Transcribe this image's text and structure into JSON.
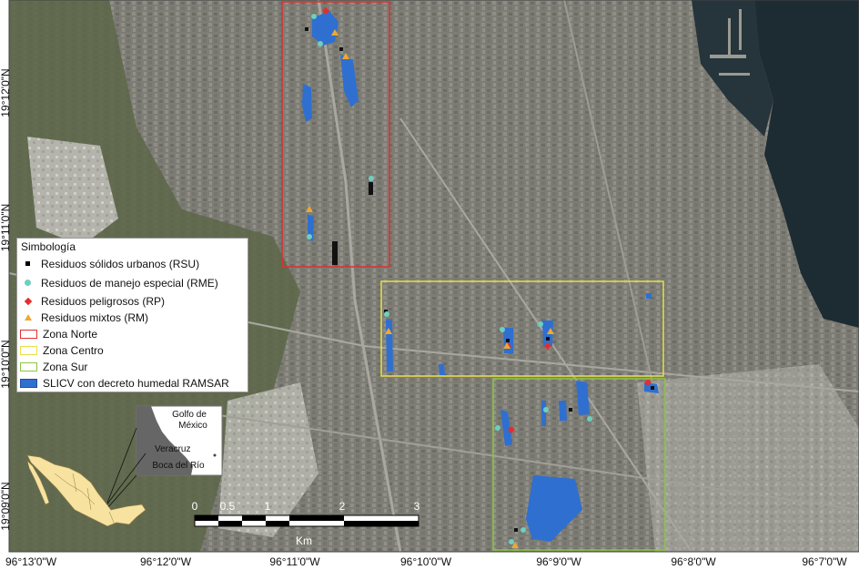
{
  "legend": {
    "title": "Simbología",
    "items": [
      {
        "label": "Residuos sólidos urbanos (RSU)",
        "icon": "black-square-icon",
        "color": "#000000"
      },
      {
        "label": "Residuos de manejo especial (RME)",
        "icon": "teal-circle-icon",
        "color": "#6ecfc0"
      },
      {
        "label": "Residuos peligrosos (RP)",
        "icon": "red-diamond-icon",
        "color": "#e52d2d"
      },
      {
        "label": "Residuos mixtos (RM)",
        "icon": "orange-triangle-icon",
        "color": "#f0a830"
      },
      {
        "label": "Zona Norte",
        "icon": "red-box-icon",
        "color": "#e03030"
      },
      {
        "label": "Zona Centro",
        "icon": "yellow-box-icon",
        "color": "#e8e04a"
      },
      {
        "label": "Zona Sur",
        "icon": "green-box-icon",
        "color": "#8cc63f"
      },
      {
        "label": "SLICV con decreto humedal RAMSAR",
        "icon": "blue-box-icon",
        "color": "#2f6fd0"
      }
    ]
  },
  "axes": {
    "x_labels": [
      "96°13'0\"W",
      "96°12'0\"W",
      "96°11'0\"W",
      "96°10'0\"W",
      "96°9'0\"W",
      "96°8'0\"W",
      "96°7'0\"W"
    ],
    "y_labels": [
      "19°12'0\"N",
      "19°11'0\"N",
      "19°10'0\"N",
      "19°09'0\"N"
    ]
  },
  "inset": {
    "gulf_label_1": "Golfo de",
    "gulf_label_2": "México",
    "city_1": "Veracruz",
    "city_2": "Boca del Río"
  },
  "scale_bar": {
    "ticks": [
      "0",
      "0.5",
      "1",
      "2",
      "3"
    ],
    "unit": "Km"
  },
  "colors": {
    "wetland": "#2f6fd0",
    "zona_norte": "#e03030",
    "zona_centro": "#e8e04a",
    "zona_sur": "#8cc63f",
    "sea": "#1d2b33",
    "urban": "#7a7a72"
  }
}
